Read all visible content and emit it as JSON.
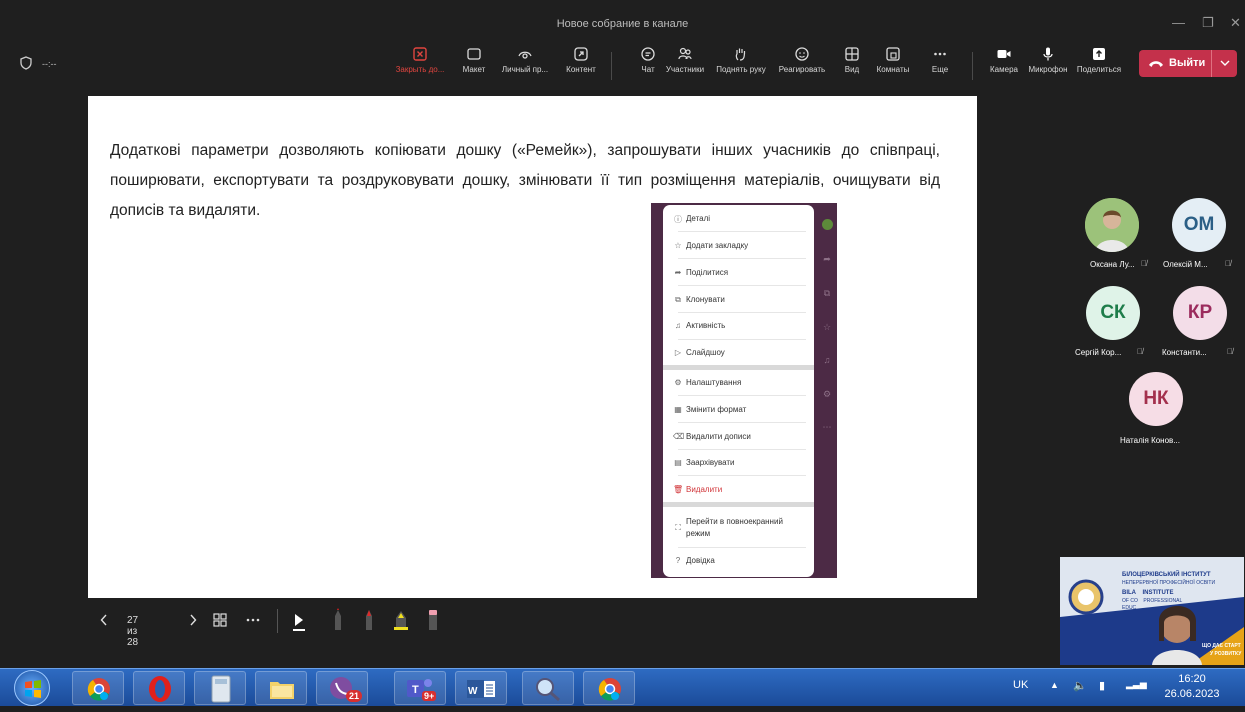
{
  "window": {
    "title": "Новое собрание в канале",
    "min": "—",
    "max": "❐",
    "close": "✕"
  },
  "meeting": {
    "timer": "--:--"
  },
  "toolbar": {
    "items": [
      {
        "label": "Закрыть до...",
        "icon": "close-square-icon"
      },
      {
        "label": "Макет",
        "icon": "layout-icon"
      },
      {
        "label": "Личный пр...",
        "icon": "eye-icon"
      },
      {
        "label": "Контент",
        "icon": "share-content-icon"
      },
      {
        "label": "Чат",
        "icon": "chat-icon"
      },
      {
        "label": "Участники",
        "icon": "people-icon"
      },
      {
        "label": "Поднять руку",
        "icon": "hand-icon"
      },
      {
        "label": "Реагировать",
        "icon": "smile-icon"
      },
      {
        "label": "Вид",
        "icon": "grid-icon"
      },
      {
        "label": "Комнаты",
        "icon": "rooms-icon"
      },
      {
        "label": "Еще",
        "icon": "more-icon"
      },
      {
        "label": "Камера",
        "icon": "camera-icon"
      },
      {
        "label": "Микрофон",
        "icon": "mic-icon"
      },
      {
        "label": "Поделиться",
        "icon": "share-up-icon"
      }
    ],
    "leave_label": "Выйти",
    "colors": {
      "leave": "#c4314b",
      "active_red": "#e0453f"
    }
  },
  "slide": {
    "text": "Додаткові параметри дозволяють копіювати дошку («Ремейк»), запрошувати інших учасників до співпраці, поширювати, експортувати та роздруковувати дошку, змінювати її тип розміщення матеріалів, очищувати від дописів та видаляти."
  },
  "menu": {
    "items": [
      {
        "label": "Деталі",
        "icon": "ⓘ"
      },
      {
        "label": "Додати закладку",
        "icon": "☆"
      },
      {
        "label": "Поділитися",
        "icon": "➦"
      },
      {
        "label": "Клонувати",
        "icon": "⧉"
      },
      {
        "label": "Активність",
        "icon": "♫"
      },
      {
        "label": "Слайдшоу",
        "icon": "▷"
      },
      {
        "label": "Налаштування",
        "icon": "⚙"
      },
      {
        "label": "Змінити формат",
        "icon": "▦"
      },
      {
        "label": "Видалити дописи",
        "icon": "⌫"
      },
      {
        "label": "Заархівувати",
        "icon": "▤"
      },
      {
        "label": "Видалити",
        "icon": "🗑"
      },
      {
        "label": "Перейти в повноекранний",
        "label2": "режим",
        "icon": "⛶"
      },
      {
        "label": "Довідка",
        "icon": "?"
      }
    ]
  },
  "participants": [
    {
      "name": "Оксана Лу...",
      "initials": "",
      "color": "#7aa35a"
    },
    {
      "name": "Олексій М...",
      "initials": "ОМ",
      "color": "#e4eef5",
      "text_color": "#2b5f86"
    },
    {
      "name": "Сергій Кор...",
      "initials": "СК",
      "color": "#dff3e8",
      "text_color": "#1e7d4a"
    },
    {
      "name": "Константи...",
      "initials": "КР",
      "color": "#f3dde8",
      "text_color": "#9b2b5d"
    },
    {
      "name": "Наталія Конов...",
      "initials": "НК",
      "color": "#f6dde6",
      "text_color": "#a3304d"
    }
  ],
  "video": {
    "line1": "БІЛОЦЕРКІВСЬКИЙ ІНСТИТУТ",
    "line2": "НЕПЕРЕРВНОЇ ПРОФЕСІЙНОЇ ОСВІТИ",
    "line3": "BILA    INSTITUTE",
    "line4": "OF CO    PROFESSIONAL",
    "line5": "EDUC",
    "corner1": "ЩО ДАЄ СТАРТ",
    "corner2": "У РОЗВИТКУ"
  },
  "slide_controls": {
    "page": "27 из 28"
  },
  "taskbar": {
    "apps": [
      "start-orb",
      "chrome-skype",
      "opera",
      "calculator",
      "file-explorer",
      "viber",
      "teams",
      "word",
      "search-tool",
      "chrome-s"
    ],
    "viber_badge": "21",
    "teams_badge": "9+",
    "lang": "UK",
    "time": "16:20",
    "date": "26.06.2023"
  }
}
